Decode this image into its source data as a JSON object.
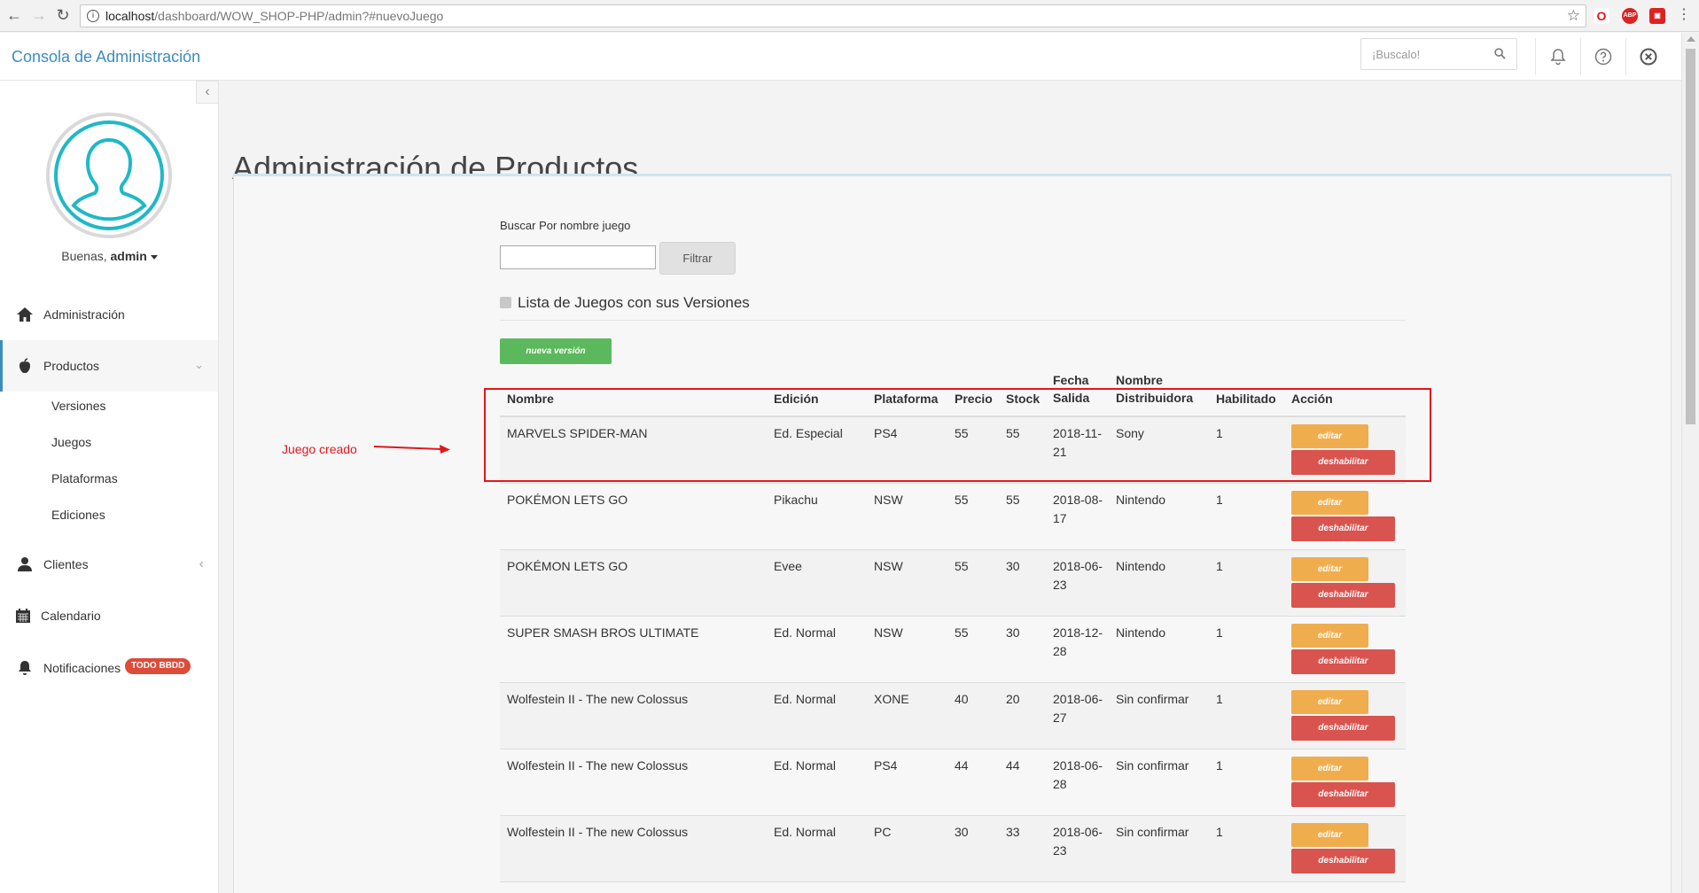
{
  "browser": {
    "url_host": "localhost",
    "url_path": "/dashboard/WOW_SHOP-PHP/admin?#nuevoJuego",
    "extensions": [
      "O",
      "ABP",
      "▣"
    ]
  },
  "header": {
    "brand": "Consola de Administración",
    "search_placeholder": "¡Buscalo!"
  },
  "sidebar": {
    "greeting": "Buenas,",
    "username": "admin",
    "items": [
      {
        "label": "Administración",
        "icon": "home-icon"
      },
      {
        "label": "Productos",
        "icon": "apple-icon"
      },
      {
        "label": "Clientes",
        "icon": "user-icon"
      },
      {
        "label": "Calendario",
        "icon": "calendar-icon"
      },
      {
        "label": "Notificaciones",
        "icon": "bell-icon",
        "badge": "TODO BBDD"
      }
    ],
    "subitems": [
      "Versiones",
      "Juegos",
      "Plataformas",
      "Ediciones"
    ]
  },
  "main": {
    "title": "Administración de Productos",
    "filter_label": "Buscar Por nombre juego",
    "filter_input_value": "",
    "filter_button": "Filtrar",
    "list_title": "Lista de Juegos con sus Versiones",
    "new_version_button": "nueva versión",
    "annotation": "Juego creado",
    "table": {
      "headers": {
        "nombre": "Nombre",
        "edicion": "Edición",
        "plataforma": "Plataforma",
        "precio": "Precio",
        "stock": "Stock",
        "fecha_1": "Fecha",
        "fecha_2": "Salida",
        "dist_1": "Nombre",
        "dist_2": "Distribuidora",
        "habilitado": "Habilitado",
        "accion": "Acción"
      },
      "edit_label": "editar",
      "disable_label": "deshabilitar",
      "rows": [
        {
          "nombre": "MARVELS SPIDER-MAN",
          "edicion": "Ed. Especial",
          "plataforma": "PS4",
          "precio": "55",
          "stock": "55",
          "fecha_1": "2018-11-",
          "fecha_2": "21",
          "distribuidora": "Sony",
          "habilitado": "1"
        },
        {
          "nombre": "POKÉMON LETS GO",
          "edicion": "Pikachu",
          "plataforma": "NSW",
          "precio": "55",
          "stock": "55",
          "fecha_1": "2018-08-",
          "fecha_2": "17",
          "distribuidora": "Nintendo",
          "habilitado": "1"
        },
        {
          "nombre": "POKÉMON LETS GO",
          "edicion": "Evee",
          "plataforma": "NSW",
          "precio": "55",
          "stock": "30",
          "fecha_1": "2018-06-",
          "fecha_2": "23",
          "distribuidora": "Nintendo",
          "habilitado": "1"
        },
        {
          "nombre": "SUPER SMASH BROS ULTIMATE",
          "edicion": "Ed. Normal",
          "plataforma": "NSW",
          "precio": "55",
          "stock": "30",
          "fecha_1": "2018-12-",
          "fecha_2": "28",
          "distribuidora": "Nintendo",
          "habilitado": "1"
        },
        {
          "nombre": "Wolfestein II - The new Colossus",
          "edicion": "Ed. Normal",
          "plataforma": "XONE",
          "precio": "40",
          "stock": "20",
          "fecha_1": "2018-06-",
          "fecha_2": "27",
          "distribuidora": "Sin confirmar",
          "habilitado": "1"
        },
        {
          "nombre": "Wolfestein II - The new Colossus",
          "edicion": "Ed. Normal",
          "plataforma": "PS4",
          "precio": "44",
          "stock": "44",
          "fecha_1": "2018-06-",
          "fecha_2": "28",
          "distribuidora": "Sin confirmar",
          "habilitado": "1"
        },
        {
          "nombre": "Wolfestein II - The new Colossus",
          "edicion": "Ed. Normal",
          "plataforma": "PC",
          "precio": "30",
          "stock": "33",
          "fecha_1": "2018-06-",
          "fecha_2": "23",
          "distribuidora": "Sin confirmar",
          "habilitado": "1"
        }
      ]
    }
  },
  "colors": {
    "brand": "#3c8dbc",
    "success": "#5cb85c",
    "warning": "#f0ad4e",
    "danger": "#d9534f",
    "annotation": "#e3161b",
    "avatar": "#1fb8c6"
  }
}
